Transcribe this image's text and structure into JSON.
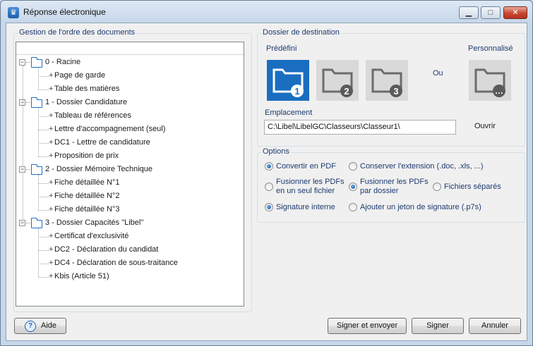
{
  "window": {
    "title": "Réponse électronique",
    "app_icon": "trophy-icon",
    "min_glyph": "▁",
    "max_glyph": "□",
    "close_glyph": "✕"
  },
  "tree_group": {
    "label": "Gestion de l'ordre des documents",
    "items": [
      {
        "label": "0 - Racine",
        "type": "folder",
        "expander": "−"
      },
      {
        "label": "Page de garde",
        "type": "doc"
      },
      {
        "label": "Table des matières",
        "type": "doc"
      },
      {
        "label": "1 - Dossier Candidature",
        "type": "folder",
        "expander": "−"
      },
      {
        "label": "Tableau de références",
        "type": "doc"
      },
      {
        "label": "Lettre d'accompagnement (seul)",
        "type": "doc"
      },
      {
        "label": "DC1 - Lettre de candidature",
        "type": "doc"
      },
      {
        "label": "Proposition de prix",
        "type": "doc"
      },
      {
        "label": "2 - Dossier Mémoire Technique",
        "type": "folder",
        "expander": "−"
      },
      {
        "label": "Fiche détaillée N°1",
        "type": "doc"
      },
      {
        "label": "Fiche détaillée N°2",
        "type": "doc"
      },
      {
        "label": "Fiche détaillée N°3",
        "type": "doc"
      },
      {
        "label": "3 - Dossier Capacités \"Libel\"",
        "type": "folder",
        "expander": "−"
      },
      {
        "label": "Certificat d'exclusivité",
        "type": "doc"
      },
      {
        "label": "DC2 - Déclaration du candidat",
        "type": "doc"
      },
      {
        "label": "DC4 - Déclaration de sous-traitance",
        "type": "doc"
      },
      {
        "label": "Kbis (Article 51)",
        "type": "doc"
      }
    ],
    "doc_marker": "+"
  },
  "destination": {
    "label": "Dossier de destination",
    "predefined_label": "Prédéfini",
    "custom_label": "Personnalisé",
    "or_label": "Ou",
    "folders": [
      {
        "badge": "1",
        "selected": true
      },
      {
        "badge": "2",
        "selected": false
      },
      {
        "badge": "3",
        "selected": false
      }
    ],
    "custom_badge": "…",
    "location_label": "Emplacement",
    "location_value": "C:\\Libel\\LibelGC\\Classeurs\\Classeur1\\",
    "open_label": "Ouvrir"
  },
  "options": {
    "label": "Options",
    "items": {
      "convert_pdf": {
        "label": "Convertir en PDF",
        "checked": true
      },
      "keep_extension": {
        "label": "Conserver l'extension (.doc, .xls, ...)",
        "checked": false
      },
      "merge_single": {
        "line1": "Fusionner les PDFs",
        "line2": "en un seul fichier",
        "checked": false
      },
      "merge_folder": {
        "line1": "Fusionner les PDFs",
        "line2": "par dossier",
        "checked": true
      },
      "separate_files": {
        "label": "Fichiers séparés",
        "checked": false
      },
      "internal_signature": {
        "label": "Signature interne",
        "checked": true
      },
      "signature_token": {
        "label": "Ajouter un jeton de signature (.p7s)",
        "checked": false
      }
    }
  },
  "buttons": {
    "help": "Aide",
    "help_glyph": "?",
    "sign_send": "Signer et envoyer",
    "sign": "Signer",
    "cancel": "Annuler"
  },
  "colors": {
    "accent": "#1a6ec0",
    "folder_grey": "#d9d9d9",
    "label_blue": "#1d3a70"
  }
}
